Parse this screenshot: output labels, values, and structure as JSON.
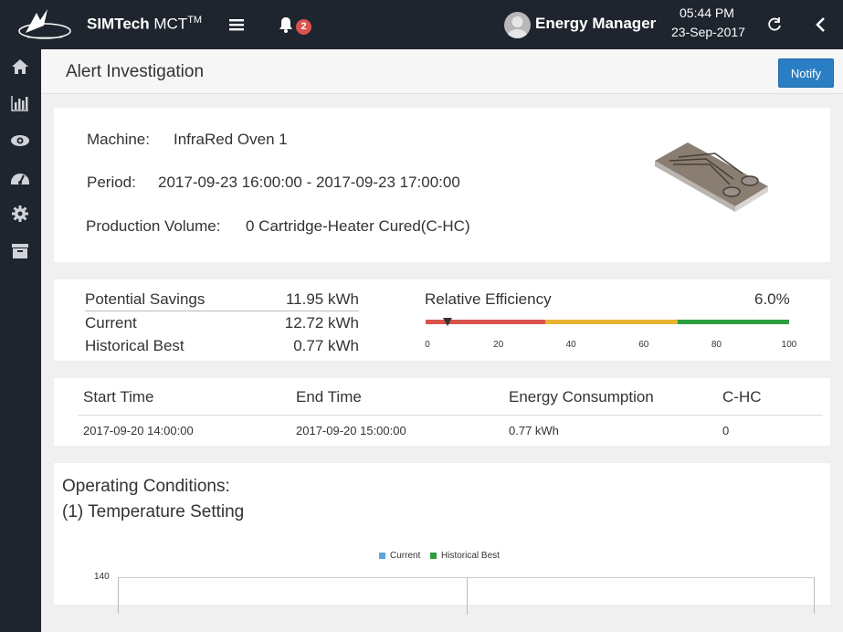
{
  "header": {
    "app_name": "SIMTech",
    "app_suffix": " MCT",
    "app_tm": "TM",
    "notification_count": "2",
    "user_name": "Energy Manager",
    "time": "05:44 PM",
    "date": "23-Sep-2017"
  },
  "page": {
    "title": "Alert Investigation",
    "notify_label": "Notify"
  },
  "info": {
    "machine_label": "Machine:",
    "machine_value": "InfraRed Oven 1",
    "period_label": "Period:",
    "period_value": "2017-09-23 16:00:00 - 2017-09-23 17:00:00",
    "volume_label": "Production Volume:",
    "volume_value": "0 Cartridge-Heater Cured(C-HC)"
  },
  "savings": {
    "rows": [
      {
        "label": "Potential Savings",
        "value": "11.95 kWh"
      },
      {
        "label": "Current",
        "value": "12.72 kWh"
      },
      {
        "label": "Historical Best",
        "value": "0.77 kWh"
      }
    ],
    "efficiency_label": "Relative Efficiency",
    "efficiency_value": "6.0%",
    "efficiency_percent": 6,
    "gauge_ticks": [
      "0",
      "20",
      "40",
      "60",
      "80",
      "100"
    ],
    "colors": {
      "red": "#d9534f",
      "yellow": "#e6b333",
      "green": "#2e9e3f"
    }
  },
  "history_table": {
    "headers": [
      "Start Time",
      "End Time",
      "Energy Consumption",
      "C-HC"
    ],
    "rows": [
      [
        "2017-09-20 14:00:00",
        "2017-09-20 15:00:00",
        "0.77 kWh",
        "0"
      ]
    ]
  },
  "operating": {
    "title": "Operating Conditions:",
    "subtitle": "(1) Temperature Setting",
    "legend": [
      {
        "name": "Current",
        "color": "#5aa6dd"
      },
      {
        "name": "Historical Best",
        "color": "#2e9e3f"
      }
    ],
    "y_tick": "140"
  }
}
